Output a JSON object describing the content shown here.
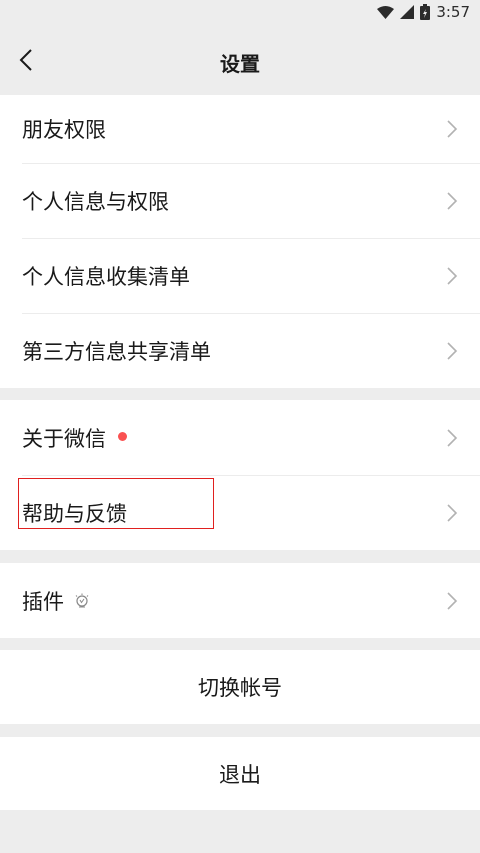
{
  "status_bar": {
    "time": "3:57",
    "icons": [
      "wifi-icon",
      "signal-icon",
      "battery-icon"
    ]
  },
  "nav": {
    "title": "设置",
    "back_icon": "chevron-left-icon"
  },
  "groups": {
    "privacy": {
      "items": [
        {
          "label": "朋友权限"
        },
        {
          "label": "个人信息与权限"
        },
        {
          "label": "个人信息收集清单"
        },
        {
          "label": "第三方信息共享清单"
        }
      ]
    },
    "about": {
      "items": [
        {
          "label": "关于微信",
          "badge": "red-dot"
        },
        {
          "label": "帮助与反馈"
        }
      ]
    },
    "plugins": {
      "items": [
        {
          "label": "插件",
          "icon": "plugin-lightbulb-icon"
        }
      ]
    }
  },
  "actions": {
    "switch_account": "切换帐号",
    "logout": "退出"
  },
  "colors": {
    "background": "#ededed",
    "card": "#ffffff",
    "badge_red": "#fa5151",
    "highlight_red": "#e0201f",
    "chevron": "#b2b2b2"
  }
}
